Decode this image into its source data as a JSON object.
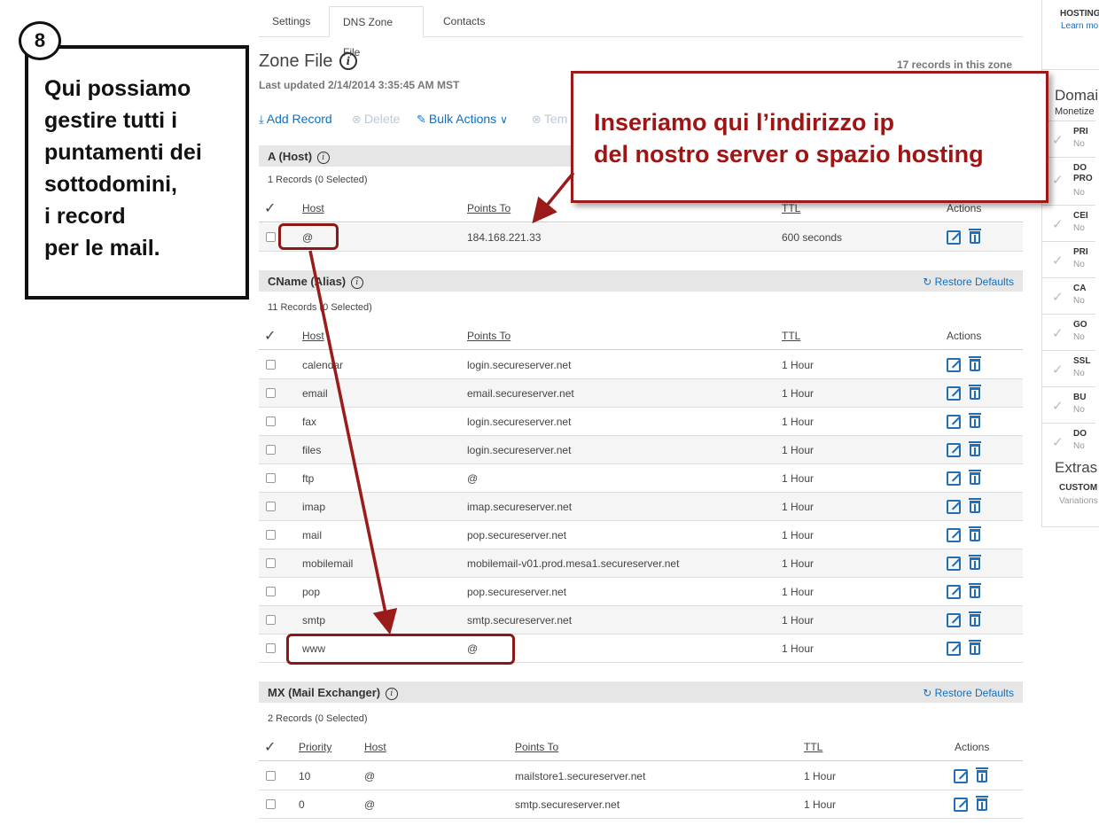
{
  "tabs": [
    {
      "label": "Settings",
      "active": false
    },
    {
      "label": "DNS Zone File",
      "active": true
    },
    {
      "label": "Contacts",
      "active": false
    }
  ],
  "zone": {
    "title": "Zone File",
    "last_updated": "Last updated 2/14/2014 3:35:45 AM MST",
    "records_count": "17 records in this zone"
  },
  "toolbar": {
    "add_record": "Add Record",
    "delete": "Delete",
    "bulk_actions": "Bulk Actions",
    "templates": "Tem"
  },
  "a_section": {
    "title": "A (Host)",
    "count": "1 Records (0 Selected)",
    "headers": {
      "host": "Host",
      "points_to": "Points To",
      "ttl": "TTL",
      "actions": "Actions"
    },
    "rows": [
      {
        "host": "@",
        "points_to": "184.168.221.33",
        "ttl": "600 seconds"
      }
    ]
  },
  "cname_section": {
    "title": "CName (Alias)",
    "restore": "Restore Defaults",
    "count": "11 Records (0 Selected)",
    "headers": {
      "host": "Host",
      "points_to": "Points To",
      "ttl": "TTL",
      "actions": "Actions"
    },
    "rows": [
      {
        "host": "calendar",
        "points_to": "login.secureserver.net",
        "ttl": "1 Hour"
      },
      {
        "host": "email",
        "points_to": "email.secureserver.net",
        "ttl": "1 Hour"
      },
      {
        "host": "fax",
        "points_to": "login.secureserver.net",
        "ttl": "1 Hour"
      },
      {
        "host": "files",
        "points_to": "login.secureserver.net",
        "ttl": "1 Hour"
      },
      {
        "host": "ftp",
        "points_to": "@",
        "ttl": "1 Hour"
      },
      {
        "host": "imap",
        "points_to": "imap.secureserver.net",
        "ttl": "1 Hour"
      },
      {
        "host": "mail",
        "points_to": "pop.secureserver.net",
        "ttl": "1 Hour"
      },
      {
        "host": "mobilemail",
        "points_to": "mobilemail-v01.prod.mesa1.secureserver.net",
        "ttl": "1 Hour"
      },
      {
        "host": "pop",
        "points_to": "pop.secureserver.net",
        "ttl": "1 Hour"
      },
      {
        "host": "smtp",
        "points_to": "smtp.secureserver.net",
        "ttl": "1 Hour"
      },
      {
        "host": "www",
        "points_to": "@",
        "ttl": "1 Hour"
      }
    ]
  },
  "mx_section": {
    "title": "MX (Mail Exchanger)",
    "restore": "Restore Defaults",
    "count": "2 Records (0 Selected)",
    "headers": {
      "priority": "Priority",
      "host": "Host",
      "points_to": "Points To",
      "ttl": "TTL",
      "actions": "Actions"
    },
    "rows": [
      {
        "priority": "10",
        "host": "@",
        "points_to": "mailstore1.secureserver.net",
        "ttl": "1 Hour"
      },
      {
        "priority": "0",
        "host": "@",
        "points_to": "smtp.secureserver.net",
        "ttl": "1 Hour"
      }
    ]
  },
  "right_panel": {
    "hosting": "HOSTING",
    "learn_more": "Learn mo",
    "domain_title": "Domai",
    "monetize": "Monetize",
    "items": [
      {
        "title": "PRI",
        "note": "No"
      },
      {
        "title": "DO\nPRO",
        "note": "No"
      },
      {
        "title": "CEI",
        "note": "No"
      },
      {
        "title": "PRI",
        "note": "No"
      },
      {
        "title": "CA",
        "note": "No"
      },
      {
        "title": "GO",
        "note": "No"
      },
      {
        "title": "SSL",
        "note": "No"
      },
      {
        "title": "BU",
        "note": "No"
      },
      {
        "title": "DO",
        "note": "No"
      }
    ],
    "extras": "Extras",
    "custom": "CUSTOM",
    "variations": "Variations"
  },
  "annotations": {
    "step": "8",
    "left_callout": "Qui possiamo\ngestire tutti i\npuntamenti dei\nsottodomini,\ni record\nper le mail.",
    "right_callout": "Inseriamo qui l’indirizzo ip\ndel nostro server o spazio hosting",
    "color": "#9b1b1b"
  },
  "colors": {
    "link": "#0f6fc6",
    "section_bg": "#e6e6e6",
    "icon_blue": "#1f6fb8"
  }
}
